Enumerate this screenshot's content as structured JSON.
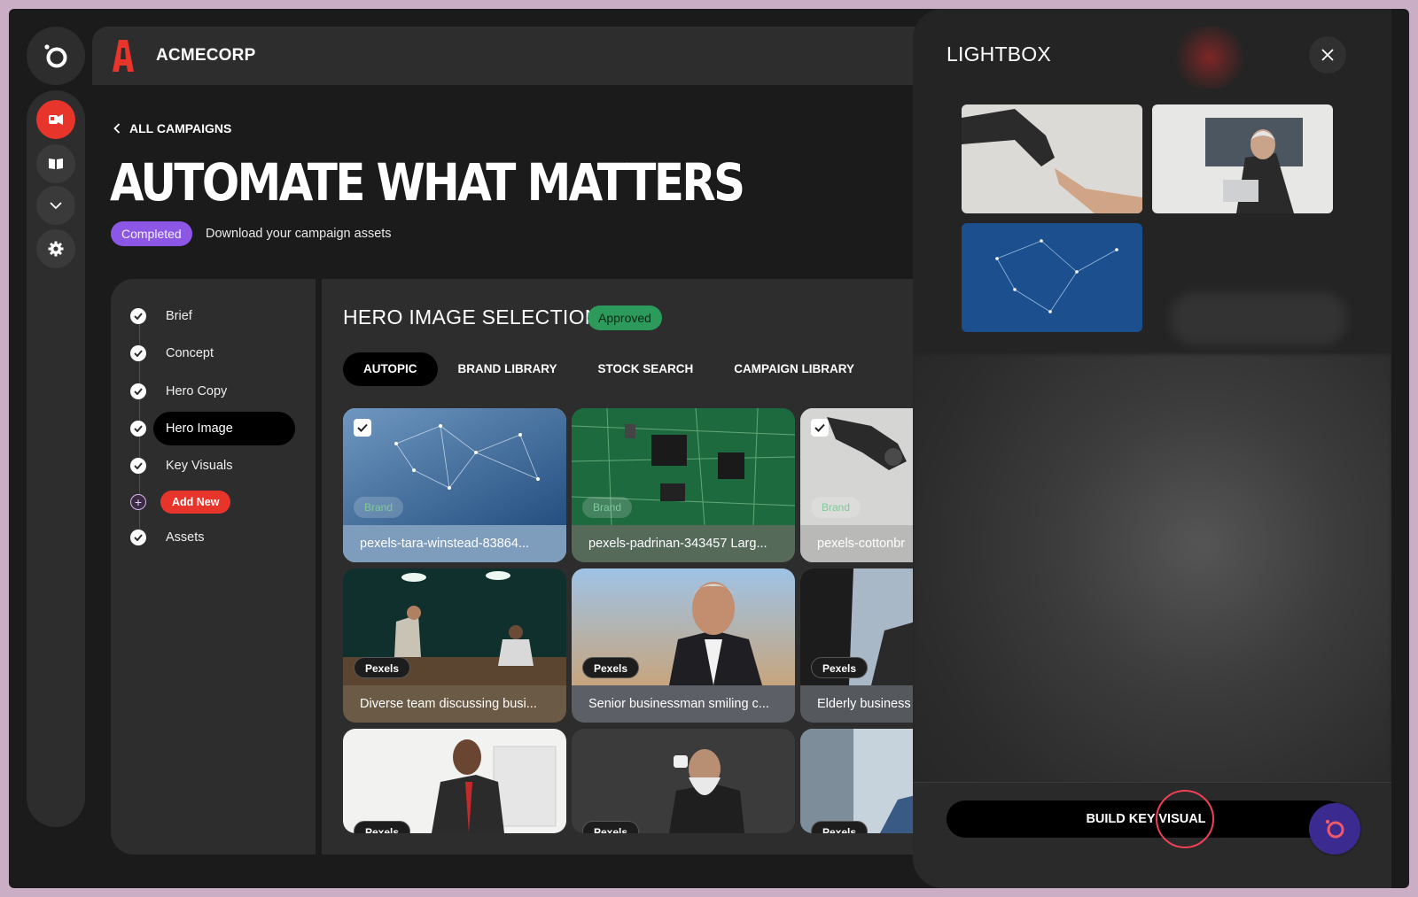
{
  "app": {
    "brand_name": "ACMECORP",
    "brand_initial": "A"
  },
  "nav": {
    "back_label": "ALL CAMPAIGNS",
    "rail_icons": [
      "megaphone-icon",
      "book-icon",
      "chevron-down-icon",
      "gear-icon"
    ]
  },
  "campaign": {
    "title": "AUTOMATE WHAT MATTERS",
    "status": "Completed",
    "status_message": "Download your campaign assets"
  },
  "steps": [
    {
      "label": "Brief",
      "done": true
    },
    {
      "label": "Concept",
      "done": true
    },
    {
      "label": "Hero Copy",
      "done": true
    },
    {
      "label": "Hero Image",
      "done": true,
      "active": true
    },
    {
      "label": "Key Visuals",
      "done": true
    },
    {
      "label": "Add New",
      "action": true
    },
    {
      "label": "Assets",
      "done": true
    }
  ],
  "section": {
    "title": "HERO IMAGE SELECTION",
    "badge": "Approved",
    "tabs": [
      "AUTOPIC",
      "BRAND LIBRARY",
      "STOCK SEARCH",
      "CAMPAIGN LIBRARY"
    ],
    "active_tab": "AUTOPIC"
  },
  "images": [
    {
      "caption": "pexels-tara-winstead-83864...",
      "source": "Brand",
      "selected": true
    },
    {
      "caption": "pexels-padrinan-343457 Larg...",
      "source": "Brand",
      "selected": false
    },
    {
      "caption": "pexels-cottonbr",
      "source": "Brand",
      "selected": true
    },
    {
      "caption": "Diverse team discussing busi...",
      "source": "Pexels",
      "selected": false
    },
    {
      "caption": "Senior businessman smiling c...",
      "source": "Pexels",
      "selected": false
    },
    {
      "caption": "Elderly business",
      "source": "Pexels",
      "selected": false
    },
    {
      "caption": "",
      "source": "Pexels",
      "selected": false
    },
    {
      "caption": "",
      "source": "Pexels",
      "selected": false
    },
    {
      "caption": "",
      "source": "Pexels",
      "selected": false
    }
  ],
  "lightbox": {
    "title": "LIGHTBOX",
    "button": "BUILD KEY VISUAL",
    "item_count": 3
  },
  "colors": {
    "accent": "#e8352c",
    "status_completed": "#8d57e6",
    "status_approved": "#2b9a5b",
    "help_fab": "#3b2a8f"
  }
}
